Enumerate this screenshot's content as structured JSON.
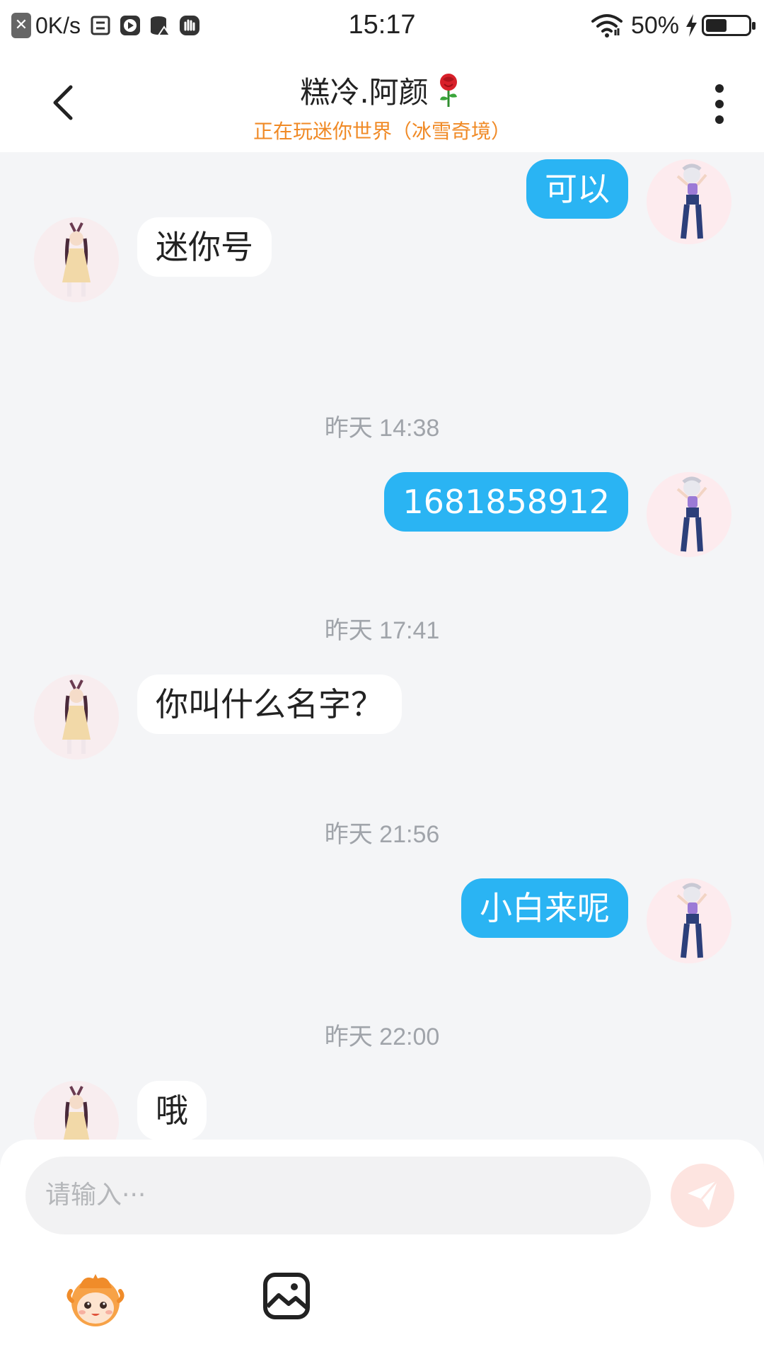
{
  "status_bar": {
    "net_speed": "0K/s",
    "time": "15:17",
    "battery_percent": "50%",
    "battery_level": 0.5,
    "icons": [
      "notification-off-icon",
      "screenshot-icon",
      "video-icon",
      "storage-icon",
      "gesture-icon",
      "wifi-icon",
      "charging-icon",
      "battery-icon"
    ]
  },
  "header": {
    "title": "糕冷.阿颜",
    "title_icon": "rose-icon",
    "subtitle": "正在玩迷你世界（冰雪奇境）",
    "subtitle_color": "#f08a26"
  },
  "messages": [
    {
      "from": "me",
      "text": "可以"
    },
    {
      "from": "them",
      "text": "迷你号"
    },
    {
      "type": "time",
      "text": "昨天 14:38"
    },
    {
      "from": "me",
      "text": "1681858912"
    },
    {
      "type": "time",
      "text": "昨天 17:41"
    },
    {
      "from": "them",
      "text": "你叫什么名字？"
    },
    {
      "type": "time",
      "text": "昨天 21:56"
    },
    {
      "from": "me",
      "text": "小白来呢"
    },
    {
      "type": "time",
      "text": "昨天 22:00"
    },
    {
      "from": "them",
      "text": "哦"
    }
  ],
  "input": {
    "placeholder": "请输入···"
  },
  "colors": {
    "my_bubble": "#2ab4f3",
    "their_bubble": "#ffffff",
    "background": "#f4f5f7",
    "send_button": "#fde4e0"
  }
}
